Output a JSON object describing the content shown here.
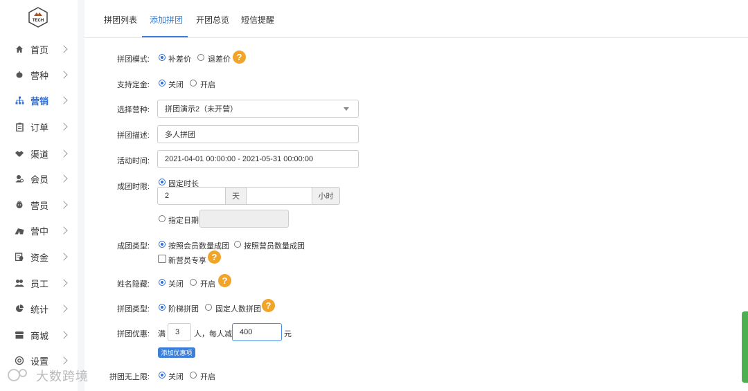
{
  "logo": {
    "text": "TECH"
  },
  "sidebar": {
    "items": [
      {
        "label": "首页",
        "icon": "home-icon"
      },
      {
        "label": "营种",
        "icon": "seed-icon"
      },
      {
        "label": "营销",
        "icon": "sitemap-icon",
        "active": true
      },
      {
        "label": "订单",
        "icon": "clipboard-icon"
      },
      {
        "label": "渠道",
        "icon": "handshake-icon"
      },
      {
        "label": "会员",
        "icon": "member-icon"
      },
      {
        "label": "营员",
        "icon": "camper-icon"
      },
      {
        "label": "营中",
        "icon": "tent-icon"
      },
      {
        "label": "资金",
        "icon": "money-icon"
      },
      {
        "label": "员工",
        "icon": "staff-icon"
      },
      {
        "label": "统计",
        "icon": "pie-chart-icon"
      },
      {
        "label": "商城",
        "icon": "store-icon"
      },
      {
        "label": "设置",
        "icon": "gear-icon"
      }
    ]
  },
  "tabs": [
    {
      "label": "拼团列表"
    },
    {
      "label": "添加拼团",
      "active": true
    },
    {
      "label": "开团总览"
    },
    {
      "label": "短信提醒"
    }
  ],
  "form": {
    "mode": {
      "label": "拼团模式:",
      "opt1": "补差价",
      "opt2": "退差价"
    },
    "deposit": {
      "label": "支持定金:",
      "opt1": "关闭",
      "opt2": "开启"
    },
    "camp": {
      "label": "选择营种:",
      "value": "拼团演示2（未开营）"
    },
    "desc": {
      "label": "拼团描述:",
      "value": "多人拼团"
    },
    "time": {
      "label": "活动时间:",
      "value": "2021-04-01 00:00:00 - 2021-05-31 00:00:00"
    },
    "limit": {
      "label": "成团时限:",
      "fixed": "固定时长",
      "days": "2",
      "days_unit": "天",
      "hours": "",
      "hours_unit": "小时",
      "specific": "指定日期"
    },
    "type": {
      "label": "成团类型:",
      "opt1": "按照会员数量成团",
      "opt2": "按照营员数量成团",
      "check": "新营员专享"
    },
    "hide": {
      "label": "姓名隐藏:",
      "opt1": "关闭",
      "opt2": "开启"
    },
    "gtype": {
      "label": "拼团类型:",
      "opt1": "阶梯拼团",
      "opt2": "固定人数拼团"
    },
    "discount": {
      "label": "拼团优惠:",
      "prefix": "满",
      "people": "3",
      "mid": "人，每人减",
      "amount": "400",
      "suffix": "元",
      "add_btn": "添加优惠项"
    },
    "unlimited": {
      "label": "拼团无上限:",
      "opt1": "关闭",
      "opt2": "开启"
    }
  },
  "help_icon": "?",
  "watermark": "大数跨境",
  "colors": {
    "accent": "#2f6fd6",
    "help": "#f0a429",
    "side_tab": "#4caf50"
  }
}
